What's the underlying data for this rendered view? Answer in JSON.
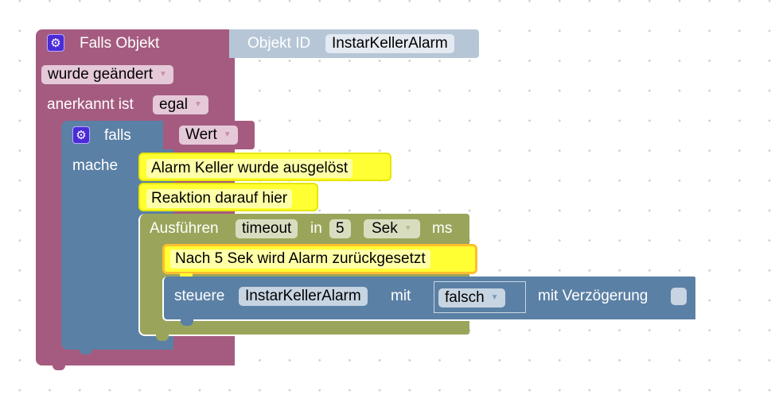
{
  "colors": {
    "trigger_block": "#a55b80",
    "if_block": "#5b80a5",
    "timeout_block": "#9aa55b",
    "comment_block": "#ffff33",
    "objid_block": "#b6c6d6"
  },
  "trigger": {
    "icon": "gear-icon",
    "title": "Falls Objekt",
    "condition_select": "wurde geändert",
    "ack_label": "anerkannt ist",
    "ack_select": "egal"
  },
  "object_id": {
    "label": "Objekt ID",
    "value": "InstarKellerAlarm"
  },
  "if_block": {
    "icon": "gear-icon",
    "if_label": "falls",
    "then_label": "mache",
    "condition_select": "Wert"
  },
  "comments": [
    "Alarm Keller wurde ausgelöst",
    "Reaktion darauf hier",
    "Nach 5 Sek wird Alarm zurückgesetzt"
  ],
  "timeout": {
    "label": "Ausführen",
    "name": "timeout",
    "in_label": "in",
    "delay": "5",
    "unit_select": "Sek",
    "unit_suffix": "ms"
  },
  "control": {
    "label": "steuere",
    "object": "InstarKellerAlarm",
    "with_label": "mit",
    "value_select": "falsch",
    "delay_label": "mit Verzögerung",
    "delay_checked": false
  }
}
